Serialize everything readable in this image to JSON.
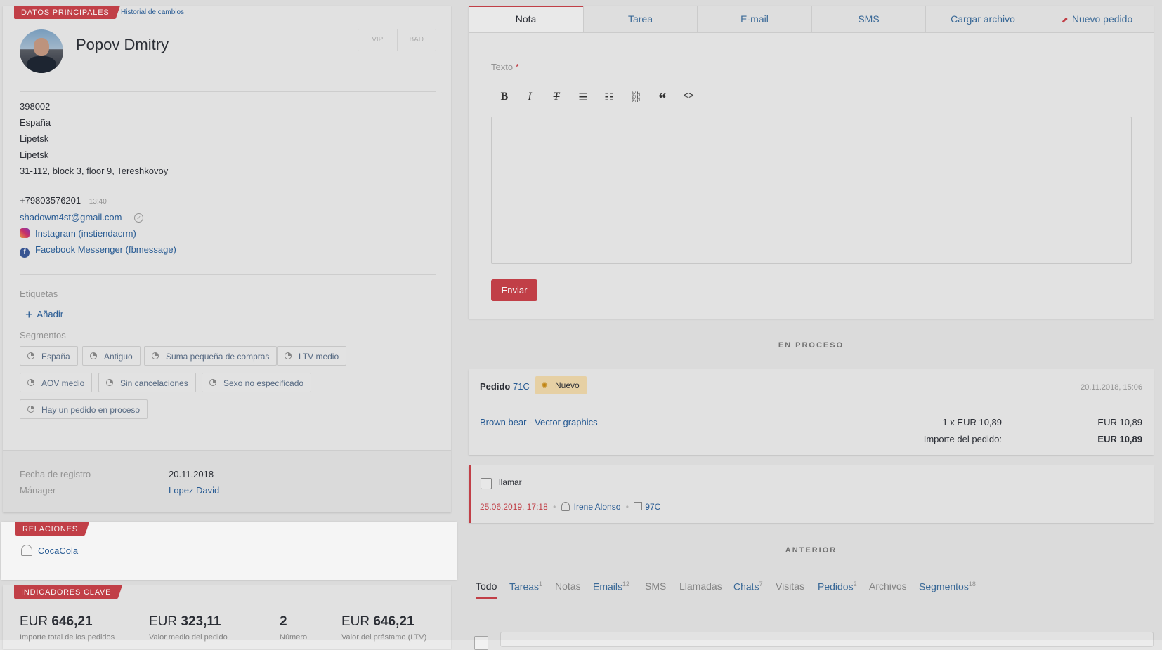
{
  "main": {
    "tag": "DATOS PRINCIPALES",
    "history_link": "Historial de cambios",
    "name": "Popov Dmitry",
    "vip": "VIP",
    "bad": "BAD",
    "address": [
      "398002",
      "España",
      "Lipetsk",
      "Lipetsk",
      "31-112, block 3, floor 9, Tereshkovoy"
    ],
    "phone": "+79803576201",
    "phone_time": "13:40",
    "email": "shadowm4st@gmail.com",
    "instagram": "Instagram (instiendacrm)",
    "facebook": "Facebook Messenger (fbmessage)",
    "labels_title": "Etiquetas",
    "add_label": "Añadir",
    "segments_title": "Segmentos",
    "segments": [
      "España",
      "Antiguo",
      "Suma pequeña de compras",
      "LTV medio",
      "AOV medio",
      "Sin cancelaciones",
      "Sexo no especificado",
      "Hay un pedido en proceso"
    ],
    "reg_label": "Fecha de registro",
    "reg_value": "20.11.2018",
    "manager_label": "Mánager",
    "manager_value": "Lopez David"
  },
  "relations": {
    "tag": "RELACIONES",
    "company": "CocaCola"
  },
  "kpi": {
    "tag": "INDICADORES CLAVE",
    "items": [
      {
        "currency": "EUR",
        "amount": "646,21",
        "label": "Importe total de los pedidos"
      },
      {
        "currency": "EUR",
        "amount": "323,11",
        "label": "Valor medio del pedido"
      },
      {
        "currency": "",
        "amount": "2",
        "label": "Número"
      },
      {
        "currency": "EUR",
        "amount": "646,21",
        "label": "Valor del préstamo (LTV)"
      }
    ]
  },
  "composer": {
    "tabs": [
      "Nota",
      "Tarea",
      "E-mail",
      "SMS",
      "Cargar archivo",
      "Nuevo pedido"
    ],
    "text_label": "Texto",
    "required": "*",
    "send": "Enviar"
  },
  "in_process": {
    "title": "EN PROCESO",
    "order_label": "Pedido",
    "order_number": "71C",
    "status": "Nuevo",
    "status_color": "#f0d9ab",
    "date": "20.11.2018, 15:06",
    "item_name": "Brown bear - Vector graphics",
    "item_qty": "1 x EUR 10,89",
    "item_total": "EUR 10,89",
    "order_total_label": "Importe del pedido:",
    "order_total": "EUR 10,89"
  },
  "task": {
    "title": "llamar",
    "due": "25.06.2019, 17:18",
    "user": "Irene Alonso",
    "ref": "97C"
  },
  "previous": {
    "title": "ANTERIOR",
    "tabs": [
      {
        "label": "Todo",
        "count": ""
      },
      {
        "label": "Tareas",
        "count": "1"
      },
      {
        "label": "Notas",
        "count": ""
      },
      {
        "label": "Emails",
        "count": "12"
      },
      {
        "label": "SMS",
        "count": ""
      },
      {
        "label": "Llamadas",
        "count": ""
      },
      {
        "label": "Chats",
        "count": "7"
      },
      {
        "label": "Visitas",
        "count": ""
      },
      {
        "label": "Pedidos",
        "count": "2"
      },
      {
        "label": "Archivos",
        "count": ""
      },
      {
        "label": "Segmentos",
        "count": "18"
      }
    ]
  }
}
